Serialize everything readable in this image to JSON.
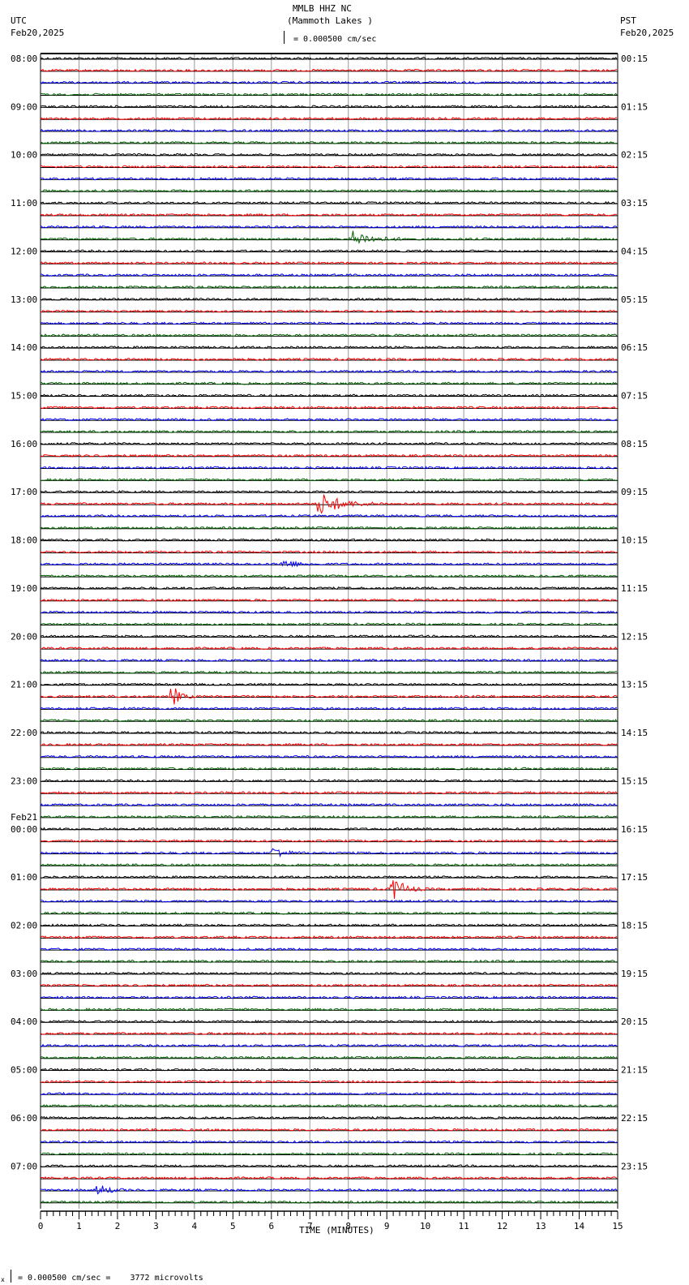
{
  "header": {
    "station": "MMLB HHZ NC",
    "location": "(Mammoth Lakes )",
    "left_tz": "UTC",
    "left_date": "Feb20,2025",
    "right_tz": "PST",
    "right_date": "Feb20,2025",
    "scale_text": "= 0.000500 cm/sec"
  },
  "footer": {
    "scale_prefix": "x",
    "scale_text": "= 0.000500 cm/sec =    3772 microvolts"
  },
  "chart_data": {
    "type": "line",
    "title": "MMLB HHZ NC (Mammoth Lakes )",
    "xlabel": "TIME (MINUTES)",
    "xlim": [
      0,
      15
    ],
    "x_ticks": [
      "0",
      "1",
      "2",
      "3",
      "4",
      "5",
      "6",
      "7",
      "8",
      "9",
      "10",
      "11",
      "12",
      "13",
      "14",
      "15"
    ],
    "rows_per_hour": 4,
    "row_minutes": 15,
    "trace_colors": [
      "#000000",
      "#ff0000",
      "#0000ff",
      "#006400"
    ],
    "left_labels": [
      "08:00",
      "09:00",
      "10:00",
      "11:00",
      "12:00",
      "13:00",
      "14:00",
      "15:00",
      "16:00",
      "17:00",
      "18:00",
      "19:00",
      "20:00",
      "21:00",
      "22:00",
      "23:00",
      "00:00",
      "01:00",
      "02:00",
      "03:00",
      "04:00",
      "05:00",
      "06:00",
      "07:00"
    ],
    "date_change_label": "Feb21",
    "right_labels": [
      "00:15",
      "01:15",
      "02:15",
      "03:15",
      "04:15",
      "05:15",
      "06:15",
      "07:15",
      "08:15",
      "09:15",
      "10:15",
      "11:15",
      "12:15",
      "13:15",
      "14:15",
      "15:15",
      "16:15",
      "17:15",
      "18:15",
      "19:15",
      "20:15",
      "21:15",
      "22:15",
      "23:15"
    ],
    "events": [
      {
        "row": 15,
        "start_min": 8.0,
        "end_min": 9.0,
        "amplitude": 3
      },
      {
        "row": 37,
        "start_min": 7.2,
        "end_min": 8.3,
        "amplitude": 4
      },
      {
        "row": 53,
        "start_min": 3.35,
        "end_min": 3.55,
        "amplitude": 3
      },
      {
        "row": 69,
        "start_min": 9.1,
        "end_min": 9.5,
        "amplitude": 4
      },
      {
        "row": 94,
        "start_min": 1.4,
        "end_min": 1.8,
        "amplitude": 2
      },
      {
        "row": 42,
        "start_min": 6.2,
        "end_min": 6.8,
        "amplitude": 1.5
      },
      {
        "row": 66,
        "start_min": 6.0,
        "end_min": 6.3,
        "amplitude": 2
      }
    ]
  }
}
